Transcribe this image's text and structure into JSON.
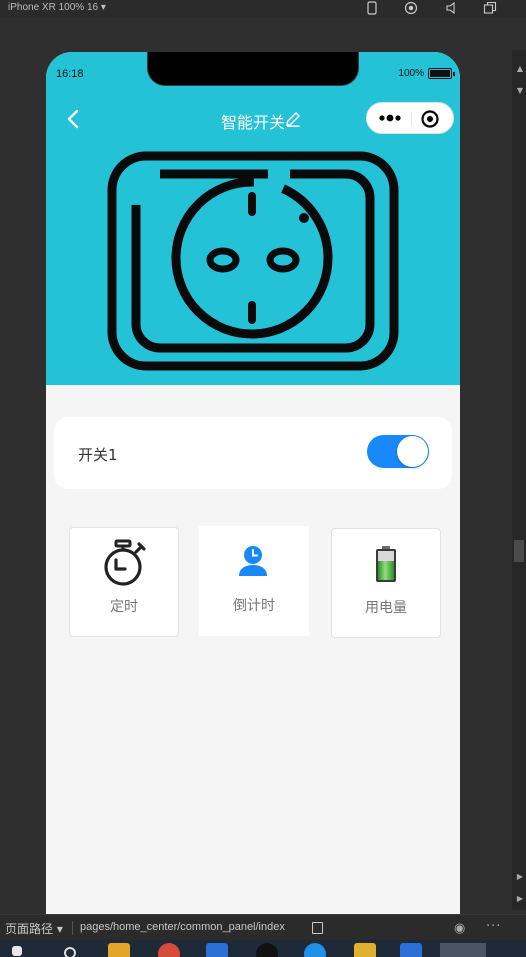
{
  "devtools": {
    "device": "iPhone XR 100% 16 ▾",
    "path_label": "页面路径 ▾",
    "path_value": "pages/home_center/common_panel/index"
  },
  "status": {
    "time": "16:18",
    "battery": "100%"
  },
  "nav": {
    "title": "智能开关"
  },
  "switch_card": {
    "label": "开关1",
    "on": true
  },
  "tiles": [
    {
      "label": "定时",
      "icon": "timer-icon"
    },
    {
      "label": "倒计时",
      "icon": "user-clock-icon"
    },
    {
      "label": "用电量",
      "icon": "battery-icon"
    }
  ],
  "colors": {
    "hero": "#23c2d7",
    "toggle_on": "#1989fa",
    "page_bg": "#f5f5f5"
  }
}
